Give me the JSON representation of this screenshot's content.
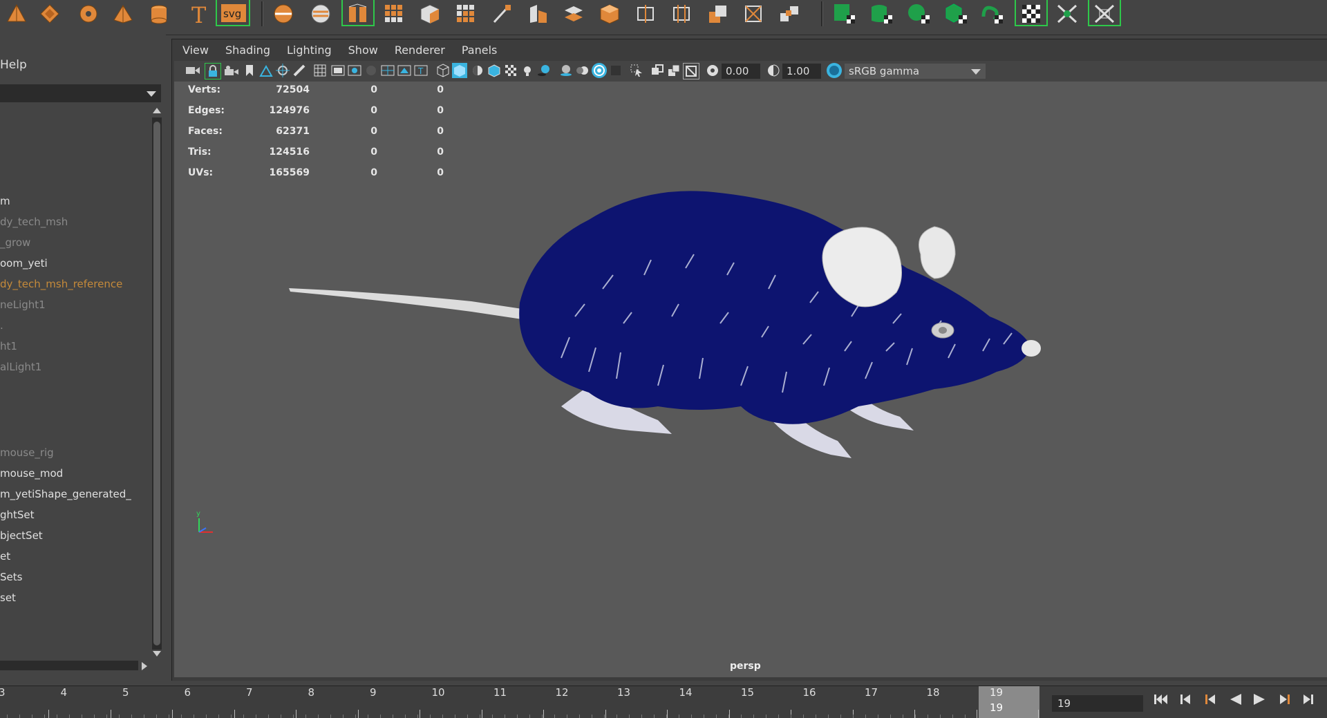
{
  "outliner": {
    "menu_help": "Help",
    "items": [
      {
        "label": "m",
        "style": "normal"
      },
      {
        "label": "dy_tech_msh",
        "style": "dim"
      },
      {
        "label": "_grow",
        "style": "dim"
      },
      {
        "label": "oom_yeti",
        "style": "normal"
      },
      {
        "label": "dy_tech_msh_reference",
        "style": "orange"
      },
      {
        "label": "neLight1",
        "style": "dim"
      },
      {
        "label": ".",
        "style": "dim"
      },
      {
        "label": "ht1",
        "style": "dim"
      },
      {
        "label": "alLight1",
        "style": "dim"
      },
      {
        "label": "mouse_rig",
        "style": "dim"
      },
      {
        "label": "mouse_mod",
        "style": "normal"
      },
      {
        "label": "m_yetiShape_generated_",
        "style": "normal"
      },
      {
        "label": "ghtSet",
        "style": "normal"
      },
      {
        "label": "bjectSet",
        "style": "normal"
      },
      {
        "label": "et",
        "style": "normal"
      },
      {
        "label": "Sets",
        "style": "normal"
      },
      {
        "label": "set",
        "style": "normal"
      }
    ]
  },
  "panel_menu": [
    "View",
    "Shading",
    "Lighting",
    "Show",
    "Renderer",
    "Panels"
  ],
  "panel_toolbar": {
    "exposure_value": "0.00",
    "gamma_value": "1.00",
    "color_space": "sRGB gamma"
  },
  "hud": {
    "rows": [
      {
        "label": "Verts:",
        "a": "72504",
        "b": "0",
        "c": "0"
      },
      {
        "label": "Edges:",
        "a": "124976",
        "b": "0",
        "c": "0"
      },
      {
        "label": "Faces:",
        "a": "62371",
        "b": "0",
        "c": "0"
      },
      {
        "label": "Tris:",
        "a": "124516",
        "b": "0",
        "c": "0"
      },
      {
        "label": "UVs:",
        "a": "165569",
        "b": "0",
        "c": "0"
      }
    ],
    "camera": "persp",
    "axis_y": "y"
  },
  "timeslider": {
    "labels": [
      "3",
      "4",
      "5",
      "6",
      "7",
      "8",
      "9",
      "10",
      "11",
      "12",
      "13",
      "14",
      "15",
      "16",
      "17",
      "18",
      "19"
    ],
    "current_frame_top": "19",
    "current_frame_bottom": "19",
    "current_frame_field": "19"
  },
  "colors": {
    "accent_orange": "#e0883a",
    "highlight_green": "#2ec84a",
    "fur_blue": "#0d1470",
    "viewport_bg": "#595959",
    "timeslider_current": "#8a8a8a",
    "icon_cyan": "#3ab4e0"
  }
}
